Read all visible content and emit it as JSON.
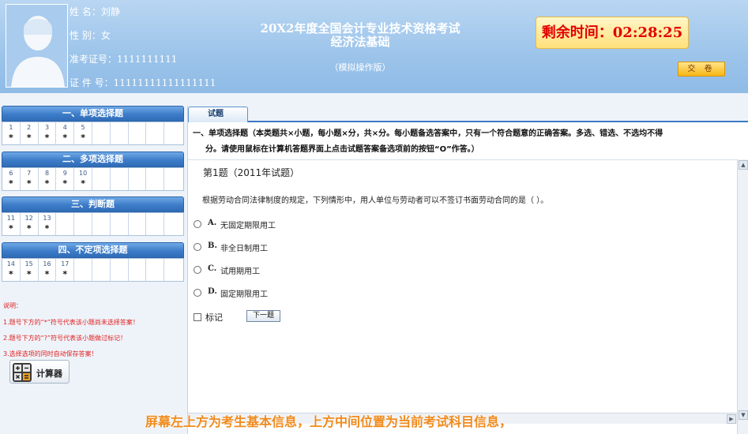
{
  "candidate": {
    "name_label": "姓      名：",
    "name": "刘静",
    "gender_label": "性      别：",
    "gender": "女",
    "ticket_label": "准考证号：",
    "ticket": "1111111111",
    "id_label": "证  件  号：",
    "id": "11111111111111111"
  },
  "exam": {
    "title": "20X2年度全国会计专业技术资格考试",
    "subject": "经济法基础",
    "mode": "（模拟操作版）"
  },
  "timer": {
    "label": "剩余时间：",
    "value": "02:28:25"
  },
  "submit_label": "交 卷",
  "sections": [
    {
      "title": "一、单项选择题",
      "questions": [
        {
          "num": "1",
          "mark": "*"
        },
        {
          "num": "2",
          "mark": "*"
        },
        {
          "num": "3",
          "mark": "*"
        },
        {
          "num": "4",
          "mark": "*"
        },
        {
          "num": "5",
          "mark": "*"
        },
        {
          "num": "",
          "mark": ""
        },
        {
          "num": "",
          "mark": ""
        },
        {
          "num": "",
          "mark": ""
        },
        {
          "num": "",
          "mark": ""
        },
        {
          "num": "",
          "mark": ""
        }
      ]
    },
    {
      "title": "二、多项选择题",
      "questions": [
        {
          "num": "6",
          "mark": "*"
        },
        {
          "num": "7",
          "mark": "*"
        },
        {
          "num": "8",
          "mark": "*"
        },
        {
          "num": "9",
          "mark": "*"
        },
        {
          "num": "10",
          "mark": "*"
        },
        {
          "num": "",
          "mark": ""
        },
        {
          "num": "",
          "mark": ""
        },
        {
          "num": "",
          "mark": ""
        },
        {
          "num": "",
          "mark": ""
        },
        {
          "num": "",
          "mark": ""
        }
      ]
    },
    {
      "title": "三、判断题",
      "questions": [
        {
          "num": "11",
          "mark": "*"
        },
        {
          "num": "12",
          "mark": "*"
        },
        {
          "num": "13",
          "mark": "*"
        },
        {
          "num": "",
          "mark": ""
        },
        {
          "num": "",
          "mark": ""
        },
        {
          "num": "",
          "mark": ""
        },
        {
          "num": "",
          "mark": ""
        },
        {
          "num": "",
          "mark": ""
        },
        {
          "num": "",
          "mark": ""
        },
        {
          "num": "",
          "mark": ""
        }
      ]
    },
    {
      "title": "四、不定项选择题",
      "questions": [
        {
          "num": "14",
          "mark": "*"
        },
        {
          "num": "15",
          "mark": "*"
        },
        {
          "num": "16",
          "mark": "*"
        },
        {
          "num": "17",
          "mark": "*"
        },
        {
          "num": "",
          "mark": ""
        },
        {
          "num": "",
          "mark": ""
        },
        {
          "num": "",
          "mark": ""
        },
        {
          "num": "",
          "mark": ""
        },
        {
          "num": "",
          "mark": ""
        },
        {
          "num": "",
          "mark": ""
        }
      ]
    }
  ],
  "notes": {
    "heading": "说明：",
    "items": [
      "1.题号下方的“*”符号代表该小题尚未选择答案！",
      "2.题号下方的“?”符号代表该小题做过标记！",
      "3.选择选项的同时自动保存答案！"
    ]
  },
  "calculator_label": "计算器",
  "tab_label": "试题",
  "instructions": {
    "line1": "一、单项选择题（本类题共×小题，每小题×分，共×分。每小题备选答案中，只有一个符合题意的正确答案。多选、错选、不选均不得",
    "line2": "分。请使用鼠标在计算机答题界面上点击试题答案备选项前的按钮“O”作答。）"
  },
  "question": {
    "number": "第1题（2011年试题）",
    "text": "根据劳动合同法律制度的规定，下列情形中，用人单位与劳动者可以不签订书面劳动合同的是（   ）。",
    "options": [
      {
        "letter": "A.",
        "text": "无固定期限用工"
      },
      {
        "letter": "B.",
        "text": "非全日制用工"
      },
      {
        "letter": "C.",
        "text": "试用期用工"
      },
      {
        "letter": "D.",
        "text": "固定期限用工"
      }
    ],
    "mark_label": "标记",
    "next_label": "下一题"
  },
  "subtitle": "屏幕左上方为考生基本信息，上方中间位置为当前考试科目信息，",
  "colors": {
    "header_bg": "#9cc4ea",
    "section_bar": "#3d7cc8",
    "timer_text": "#e20000",
    "notes_text": "#e02020",
    "subtitle_text": "#f08a1c"
  }
}
